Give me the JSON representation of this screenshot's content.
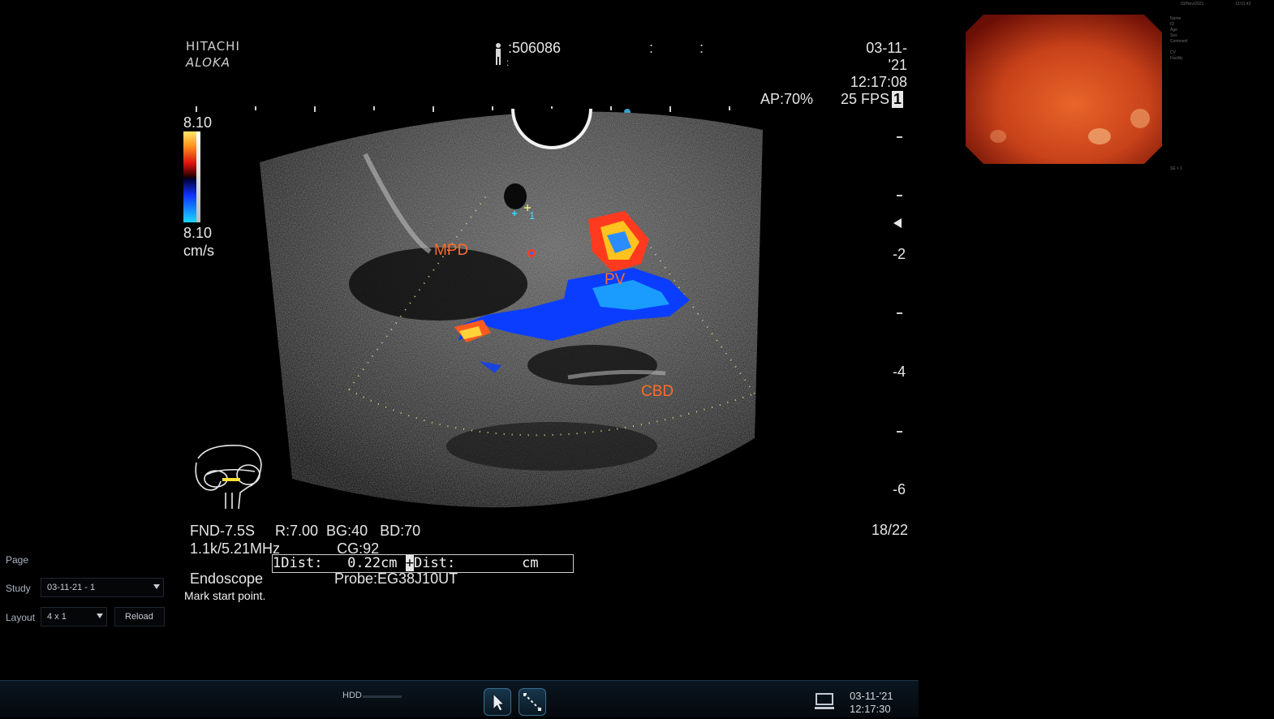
{
  "header": {
    "brand_line1": "HITACHI",
    "brand_line2": "ALOKA",
    "patient_id": ":506086",
    "patient_id_sub": ":",
    "colon_a": ":",
    "colon_b": ":",
    "date": "03-11-'21",
    "time": "12:17:08",
    "ap": "AP:70%",
    "fps": "25 FPS",
    "fps_badge": "1"
  },
  "color_scale": {
    "top": "8.10",
    "bottom": "8.10",
    "unit": "cm/s"
  },
  "depth_scale": {
    "labels": [
      "-2",
      "-4",
      "-6"
    ]
  },
  "annotations": {
    "mpd": "MPD",
    "pv": "PV",
    "cbd": "CBD",
    "marker": "1"
  },
  "params": {
    "line1": "FND-7.5S     R:7.00  BG:40   BD:70",
    "line2": "1.1k/5.21MHz              CG:92",
    "frame": "18/22",
    "dist1": "Dist:   0.22cm ",
    "dist1_index": "1",
    "dist2": "Dist:        cm",
    "dist2_marker": "+",
    "mode": "Endoscope",
    "probe": "Probe:EG38J10UT",
    "status": "Mark start point."
  },
  "side_panel": {
    "page_label": "Page",
    "study_label": "Study",
    "study_value": "03-11-21 - 1",
    "layout_label": "Layout",
    "layout_value": "4 x 1",
    "reload_label": "Reload"
  },
  "taskbar": {
    "hdd_label": "HDD",
    "date": "03-11-'21",
    "time": "12:17:30"
  },
  "thumbnail_info": {
    "top_date": "03/Nov/2021",
    "top_time": "12:01:42",
    "fields": [
      "Name",
      "ID",
      "Age",
      "Sex",
      "Comment",
      "",
      "CV",
      "Facility"
    ],
    "footer": "SE > 1"
  },
  "colors": {
    "annotation": "#ff6a2a",
    "text": "#e6e6e6",
    "background": "#000000",
    "taskbar_border": "#1b3346"
  },
  "icons": [
    "person-icon",
    "pointer-icon",
    "measure-icon",
    "monitor-icon",
    "chevron-down-icon",
    "pancreas-diagram-icon"
  ]
}
